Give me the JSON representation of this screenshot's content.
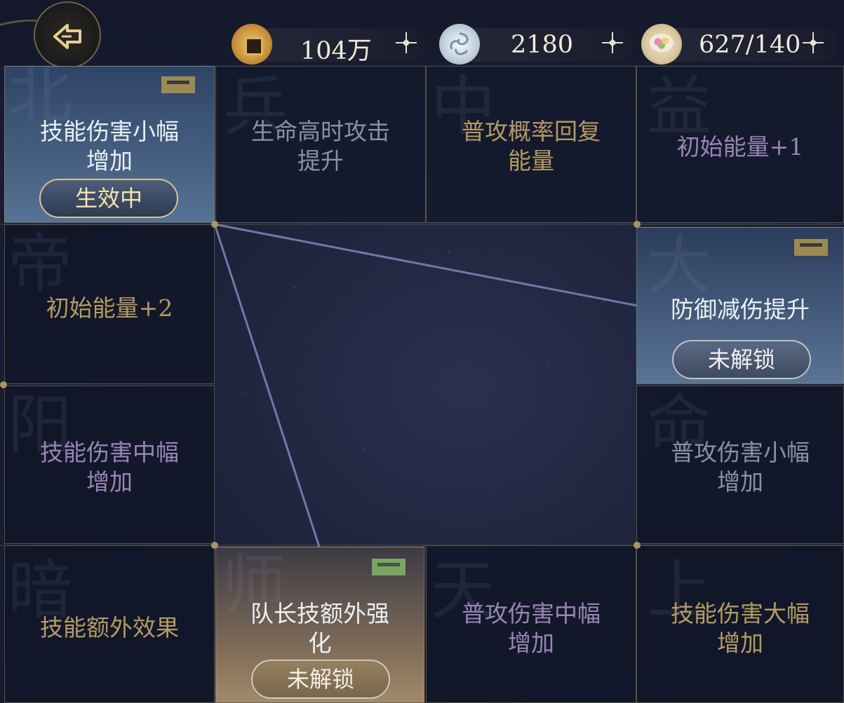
{
  "currencies": [
    {
      "name": "copper-coin",
      "value": "104万"
    },
    {
      "name": "jade-token",
      "value": "2180"
    },
    {
      "name": "food-bowl",
      "value": "627/140"
    }
  ],
  "cells": {
    "r1c1": {
      "label": "技能伤害小幅\n增加",
      "status": "生效中",
      "bg_char": "北"
    },
    "r1c2": {
      "label": "生命高时攻击\n提升",
      "bg_char": "兵"
    },
    "r1c3": {
      "label": "普攻概率回复\n能量",
      "bg_char": "中"
    },
    "r1c4": {
      "label": "初始能量+1",
      "bg_char": "益"
    },
    "r2c1": {
      "label": "初始能量+2",
      "bg_char": "帝"
    },
    "r2c4": {
      "label": "防御减伤提升",
      "status": "未解锁",
      "bg_char": "大"
    },
    "r3c1": {
      "label": "技能伤害中幅\n增加",
      "bg_char": "阳"
    },
    "r3c4": {
      "label": "普攻伤害小幅\n增加",
      "bg_char": "命"
    },
    "r4c1": {
      "label": "技能额外效果",
      "bg_char": "暗"
    },
    "r4c2": {
      "label": "队长技额外强\n化",
      "status": "未解锁",
      "bg_char": "师"
    },
    "r4c3": {
      "label": "普攻伤害中幅\n增加",
      "bg_char": "天"
    },
    "r4c4": {
      "label": "技能伤害大幅\n增加",
      "bg_char": "上"
    }
  },
  "colors": {
    "gold_text": "#b59a62",
    "purple_text": "#9a84b6",
    "grey_text": "#8592a4",
    "link_line": "#7377a8"
  }
}
